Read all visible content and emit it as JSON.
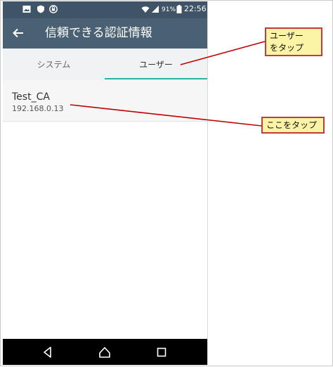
{
  "status_bar": {
    "battery_percent": "91%",
    "time": "22:56",
    "icons": [
      "image-icon",
      "shield-icon",
      "sync-icon",
      "wifi-icon",
      "signal-icon",
      "battery-icon"
    ]
  },
  "app_bar": {
    "title": "信頼できる認証情報",
    "back_icon": "arrow-left-icon"
  },
  "tabs": [
    {
      "label": "システム",
      "selected": false
    },
    {
      "label": "ユーザー",
      "selected": true
    }
  ],
  "certificates": [
    {
      "name": "Test_CA",
      "address": "192.168.0.13"
    }
  ],
  "nav_bar": {
    "icons": [
      "back-triangle-icon",
      "home-icon",
      "recents-icon"
    ]
  },
  "annotations": {
    "tap_user_tab": "ユーザー\nをタップ",
    "tap_here": "ここをタップ"
  },
  "colors": {
    "status_bar": "#3f5466",
    "app_bar": "#4a6073",
    "tab_indicator": "#26b2ad",
    "callout_fill": "#fbf3a6",
    "callout_border": "#c23a3a",
    "arrow": "#c00000"
  }
}
